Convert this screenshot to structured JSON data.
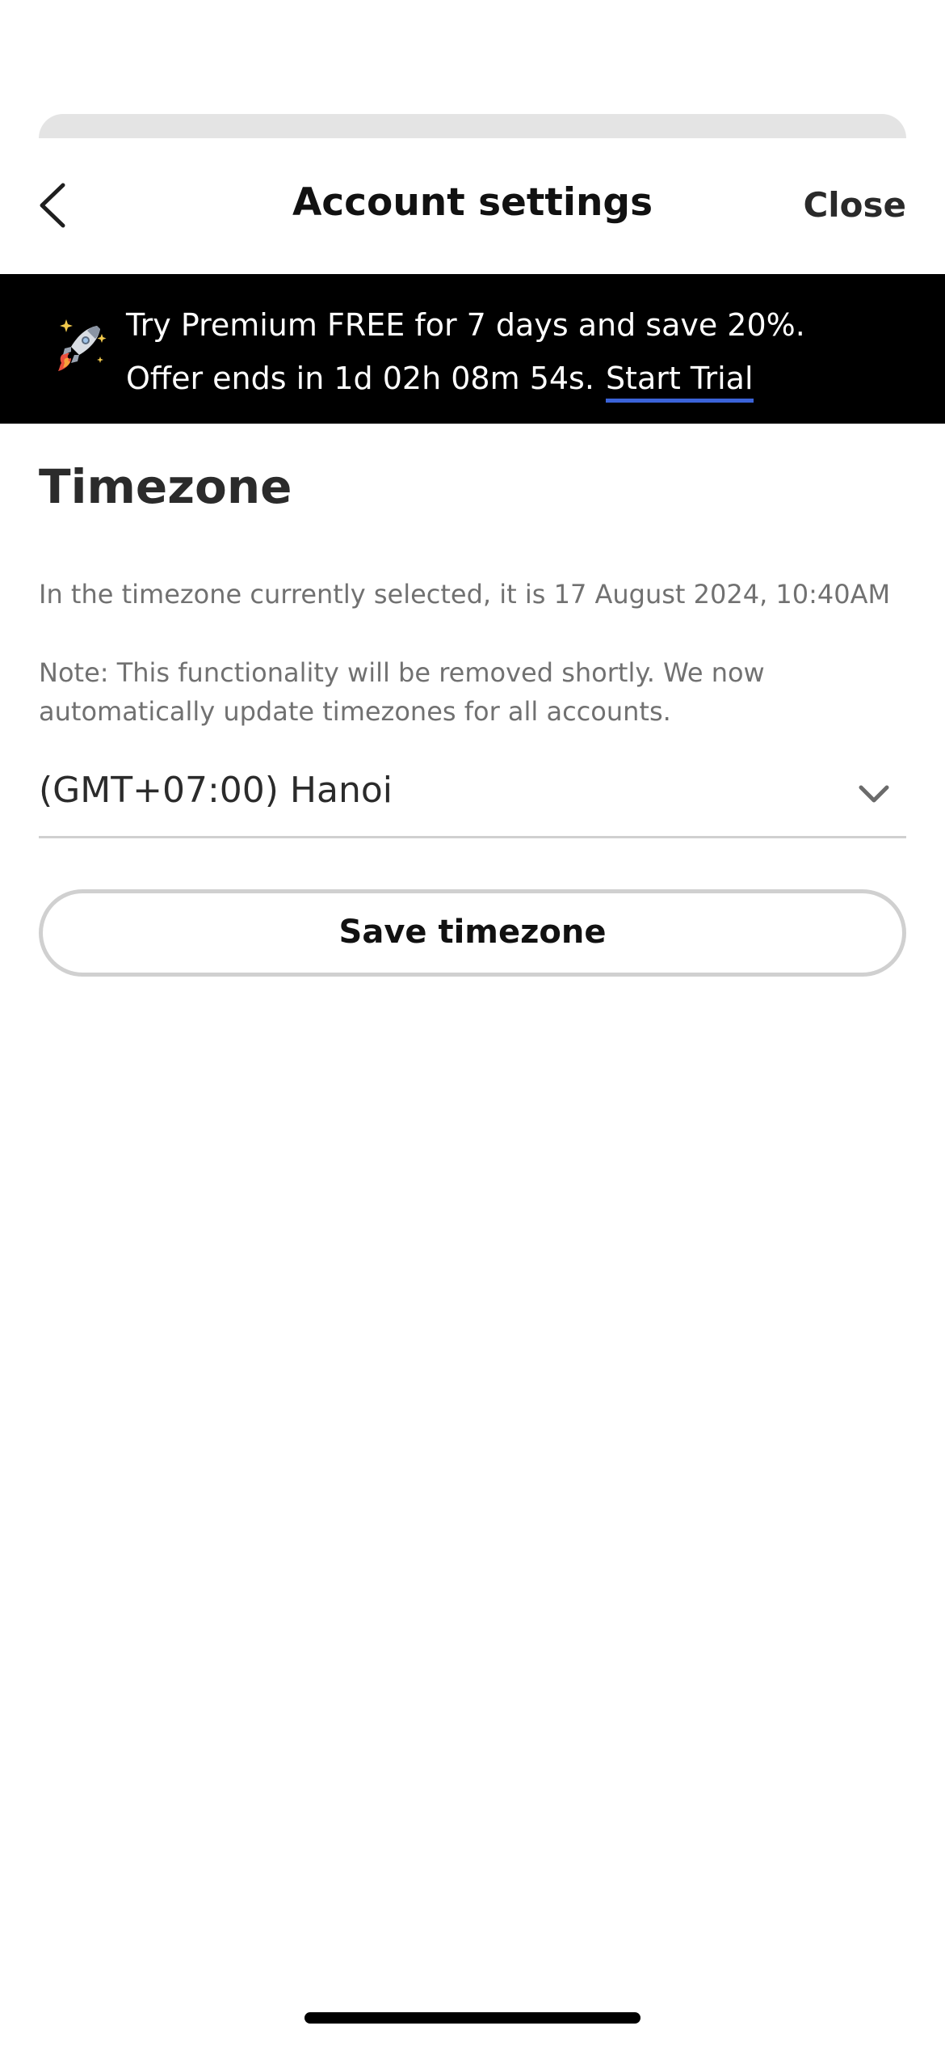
{
  "header": {
    "title": "Account settings",
    "close_label": "Close",
    "back_icon": "chevron-left-icon"
  },
  "promo": {
    "icon": "rocket-icon",
    "text": "Try Premium FREE for 7 days and save 20%. Offer ends in 1d 02h 08m 54s.",
    "link_label": "Start Trial",
    "link_color": "#3b63d8",
    "background": "#000000"
  },
  "timezone": {
    "title": "Timezone",
    "current_info": "In the timezone currently selected, it is 17 August 2024, 10:40AM",
    "note": "Note: This functionality will be removed shortly. We now automatically update timezones for all accounts.",
    "selected_value": "(GMT+07:00) Hanoi",
    "dropdown_icon": "chevron-down-icon",
    "save_label": "Save timezone"
  }
}
